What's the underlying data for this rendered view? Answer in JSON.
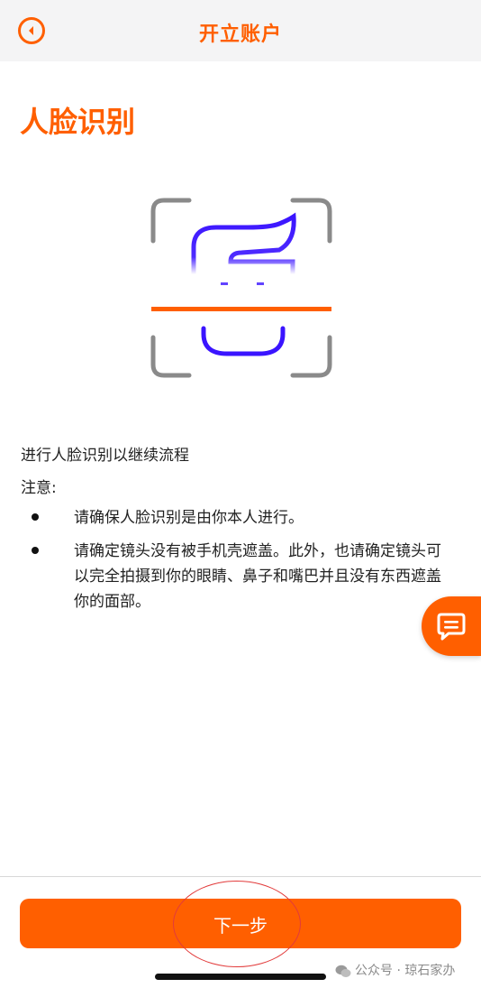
{
  "header": {
    "title": "开立账户"
  },
  "page_title": "人脸识别",
  "description": "进行人脸识别以继续流程",
  "note_label": "注意:",
  "bullets": [
    "请确保人脸识别是由你本人进行。",
    "请确定镜头没有被手机壳遮盖。此外，也请确定镜头可以完全拍摄到你的眼睛、鼻子和嘴巴并且没有东西遮盖你的面部。"
  ],
  "next_button": "下一步",
  "watermark": "公众号 · 琼石家办",
  "colors": {
    "accent": "#ff5f00",
    "face_line": "#3a14ff",
    "frame": "#8a8a8a"
  },
  "icons": {
    "back": "back-circle-icon",
    "chat": "chat-bubble-icon",
    "watermark": "wechat-icon"
  }
}
